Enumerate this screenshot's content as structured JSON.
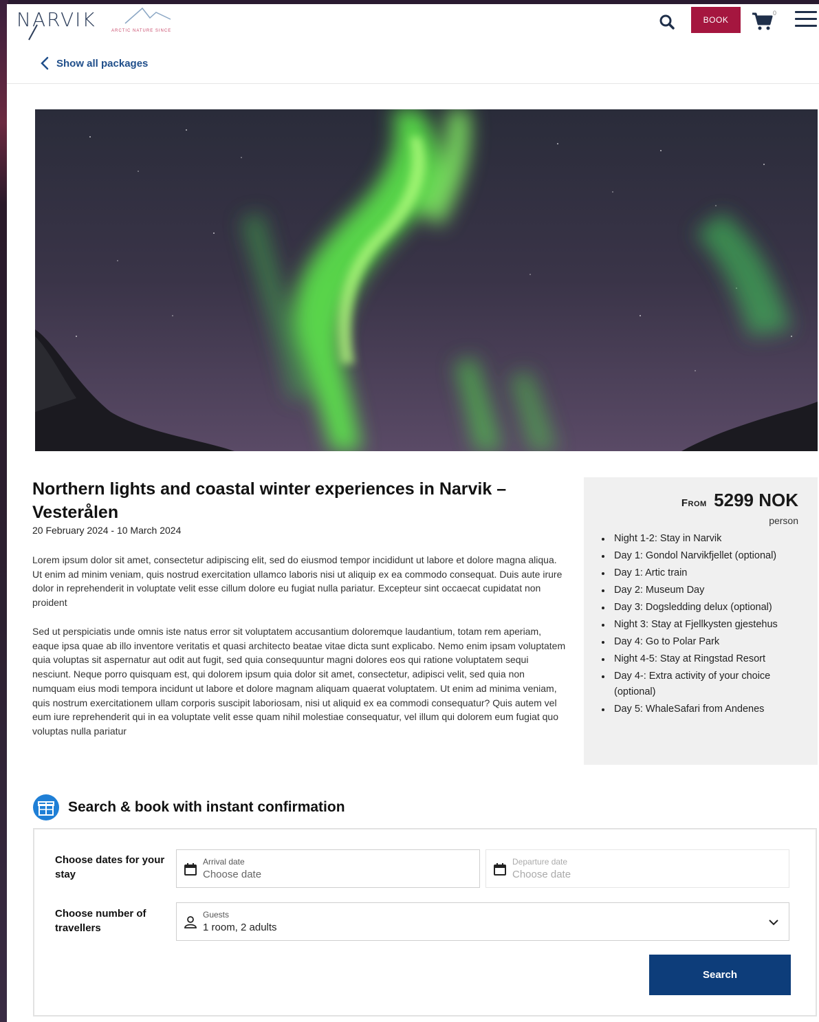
{
  "header": {
    "logo_text": "NARVIK",
    "logo_tagline": "ARCTIC NATURE SINCE",
    "back_link": "Show all packages",
    "book_label": "BOOK",
    "cart_count": "0"
  },
  "package": {
    "title": "Northern lights and coastal winter experiences in Narvik – Vesterålen",
    "dates": "20 February 2024 - 10 March 2024",
    "paragraph1": "Lorem ipsum dolor sit amet, consectetur adipiscing elit, sed do eiusmod tempor incididunt ut labore et dolore magna aliqua. Ut enim ad minim veniam, quis nostrud exercitation ullamco laboris nisi ut aliquip ex ea commodo consequat. Duis aute irure dolor in reprehenderit in voluptate velit esse cillum dolore eu fugiat nulla pariatur. Excepteur sint occaecat cupidatat non proident",
    "paragraph2": "Sed ut perspiciatis unde omnis iste natus error sit voluptatem accusantium doloremque laudantium, totam rem aperiam, eaque ipsa quae ab illo inventore veritatis et quasi architecto beatae vitae dicta sunt explicabo. Nemo enim ipsam voluptatem quia voluptas sit aspernatur aut odit aut fugit, sed quia consequuntur magni dolores eos qui ratione voluptatem sequi nesciunt. Neque porro quisquam est, qui dolorem ipsum quia dolor sit amet, consectetur, adipisci velit, sed quia non numquam eius modi tempora incidunt ut labore et dolore magnam aliquam quaerat voluptatem. Ut enim ad minima veniam, quis nostrum exercitationem ullam corporis suscipit laboriosam, nisi ut aliquid ex ea commodi consequatur? Quis autem vel eum iure reprehenderit qui in ea voluptate velit esse quam nihil molestiae consequatur, vel illum qui dolorem eum fugiat quo voluptas nulla pariatur"
  },
  "price": {
    "from_label": "From",
    "amount": "5299 NOK",
    "unit": "person"
  },
  "itinerary": [
    "Night 1-2: Stay in Narvik",
    "Day 1: Gondol Narvikfjellet (optional)",
    "Day 1: Artic train",
    "Day 2: Museum Day",
    "Day 3: Dogsledding delux (optional)",
    "Night 3: Stay at Fjellkysten gjestehus",
    "Day 4: Go to Polar Park",
    "Night 4-5: Stay at Ringstad Resort",
    "Day 4-: Extra activity of your choice (optional)",
    "Day 5: WhaleSafari from Andenes"
  ],
  "booking": {
    "heading": "Search & book with instant confirmation",
    "dates_label": "Choose dates for your stay",
    "travellers_label": "Choose number of travellers",
    "arrival_label": "Arrival date",
    "arrival_value": "Choose date",
    "departure_label": "Departure date",
    "departure_value": "Choose date",
    "guests_label": "Guests",
    "guests_value": "1 room, 2 adults",
    "search_label": "Search"
  },
  "colors": {
    "brand_red": "#a5163f",
    "primary_blue": "#0d3d7a",
    "link_blue": "#1f4e8a",
    "panel_gray": "#f0f0f0"
  },
  "icons": [
    "search-icon",
    "cart-icon",
    "hamburger-menu-icon",
    "chevron-left-icon",
    "gift-icon",
    "calendar-icon",
    "person-icon",
    "chevron-down-icon"
  ]
}
